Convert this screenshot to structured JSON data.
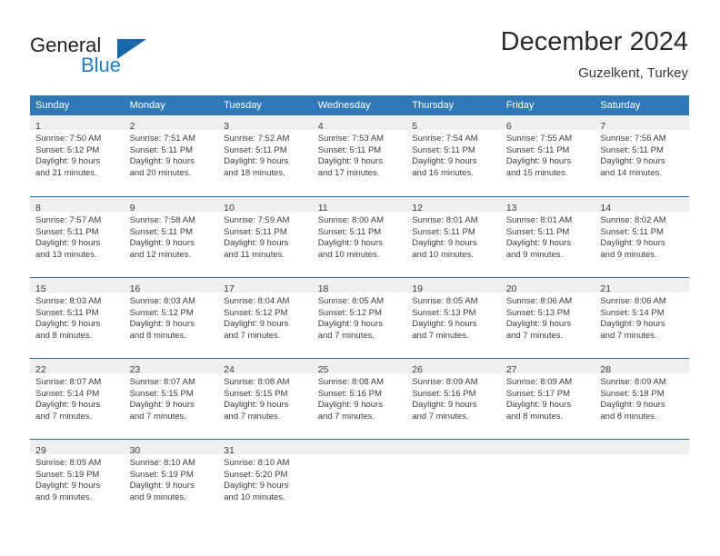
{
  "brand": {
    "name_part1": "General",
    "name_part2": "Blue",
    "triangle_icon": "triangle-logo-icon",
    "blue": "#1f7fc4",
    "dark_blue": "#1767ac"
  },
  "header": {
    "title": "December 2024",
    "subtitle": "Guzelkent, Turkey"
  },
  "theme": {
    "header_blue": "#3079b8",
    "row_divider_blue": "#2e6da4",
    "daynum_band": "#efefef",
    "text": "#3d3d3d"
  },
  "weekday_headers": [
    "Sunday",
    "Monday",
    "Tuesday",
    "Wednesday",
    "Thursday",
    "Friday",
    "Saturday"
  ],
  "weeks": [
    [
      {
        "day": "1",
        "sunrise": "Sunrise: 7:50 AM",
        "sunset": "Sunset: 5:12 PM",
        "daylight1": "Daylight: 9 hours",
        "daylight2": "and 21 minutes."
      },
      {
        "day": "2",
        "sunrise": "Sunrise: 7:51 AM",
        "sunset": "Sunset: 5:11 PM",
        "daylight1": "Daylight: 9 hours",
        "daylight2": "and 20 minutes."
      },
      {
        "day": "3",
        "sunrise": "Sunrise: 7:52 AM",
        "sunset": "Sunset: 5:11 PM",
        "daylight1": "Daylight: 9 hours",
        "daylight2": "and 18 minutes."
      },
      {
        "day": "4",
        "sunrise": "Sunrise: 7:53 AM",
        "sunset": "Sunset: 5:11 PM",
        "daylight1": "Daylight: 9 hours",
        "daylight2": "and 17 minutes."
      },
      {
        "day": "5",
        "sunrise": "Sunrise: 7:54 AM",
        "sunset": "Sunset: 5:11 PM",
        "daylight1": "Daylight: 9 hours",
        "daylight2": "and 16 minutes."
      },
      {
        "day": "6",
        "sunrise": "Sunrise: 7:55 AM",
        "sunset": "Sunset: 5:11 PM",
        "daylight1": "Daylight: 9 hours",
        "daylight2": "and 15 minutes."
      },
      {
        "day": "7",
        "sunrise": "Sunrise: 7:56 AM",
        "sunset": "Sunset: 5:11 PM",
        "daylight1": "Daylight: 9 hours",
        "daylight2": "and 14 minutes."
      }
    ],
    [
      {
        "day": "8",
        "sunrise": "Sunrise: 7:57 AM",
        "sunset": "Sunset: 5:11 PM",
        "daylight1": "Daylight: 9 hours",
        "daylight2": "and 13 minutes."
      },
      {
        "day": "9",
        "sunrise": "Sunrise: 7:58 AM",
        "sunset": "Sunset: 5:11 PM",
        "daylight1": "Daylight: 9 hours",
        "daylight2": "and 12 minutes."
      },
      {
        "day": "10",
        "sunrise": "Sunrise: 7:59 AM",
        "sunset": "Sunset: 5:11 PM",
        "daylight1": "Daylight: 9 hours",
        "daylight2": "and 11 minutes."
      },
      {
        "day": "11",
        "sunrise": "Sunrise: 8:00 AM",
        "sunset": "Sunset: 5:11 PM",
        "daylight1": "Daylight: 9 hours",
        "daylight2": "and 10 minutes."
      },
      {
        "day": "12",
        "sunrise": "Sunrise: 8:01 AM",
        "sunset": "Sunset: 5:11 PM",
        "daylight1": "Daylight: 9 hours",
        "daylight2": "and 10 minutes."
      },
      {
        "day": "13",
        "sunrise": "Sunrise: 8:01 AM",
        "sunset": "Sunset: 5:11 PM",
        "daylight1": "Daylight: 9 hours",
        "daylight2": "and 9 minutes."
      },
      {
        "day": "14",
        "sunrise": "Sunrise: 8:02 AM",
        "sunset": "Sunset: 5:11 PM",
        "daylight1": "Daylight: 9 hours",
        "daylight2": "and 9 minutes."
      }
    ],
    [
      {
        "day": "15",
        "sunrise": "Sunrise: 8:03 AM",
        "sunset": "Sunset: 5:11 PM",
        "daylight1": "Daylight: 9 hours",
        "daylight2": "and 8 minutes."
      },
      {
        "day": "16",
        "sunrise": "Sunrise: 8:03 AM",
        "sunset": "Sunset: 5:12 PM",
        "daylight1": "Daylight: 9 hours",
        "daylight2": "and 8 minutes."
      },
      {
        "day": "17",
        "sunrise": "Sunrise: 8:04 AM",
        "sunset": "Sunset: 5:12 PM",
        "daylight1": "Daylight: 9 hours",
        "daylight2": "and 7 minutes."
      },
      {
        "day": "18",
        "sunrise": "Sunrise: 8:05 AM",
        "sunset": "Sunset: 5:12 PM",
        "daylight1": "Daylight: 9 hours",
        "daylight2": "and 7 minutes."
      },
      {
        "day": "19",
        "sunrise": "Sunrise: 8:05 AM",
        "sunset": "Sunset: 5:13 PM",
        "daylight1": "Daylight: 9 hours",
        "daylight2": "and 7 minutes."
      },
      {
        "day": "20",
        "sunrise": "Sunrise: 8:06 AM",
        "sunset": "Sunset: 5:13 PM",
        "daylight1": "Daylight: 9 hours",
        "daylight2": "and 7 minutes."
      },
      {
        "day": "21",
        "sunrise": "Sunrise: 8:06 AM",
        "sunset": "Sunset: 5:14 PM",
        "daylight1": "Daylight: 9 hours",
        "daylight2": "and 7 minutes."
      }
    ],
    [
      {
        "day": "22",
        "sunrise": "Sunrise: 8:07 AM",
        "sunset": "Sunset: 5:14 PM",
        "daylight1": "Daylight: 9 hours",
        "daylight2": "and 7 minutes."
      },
      {
        "day": "23",
        "sunrise": "Sunrise: 8:07 AM",
        "sunset": "Sunset: 5:15 PM",
        "daylight1": "Daylight: 9 hours",
        "daylight2": "and 7 minutes."
      },
      {
        "day": "24",
        "sunrise": "Sunrise: 8:08 AM",
        "sunset": "Sunset: 5:15 PM",
        "daylight1": "Daylight: 9 hours",
        "daylight2": "and 7 minutes."
      },
      {
        "day": "25",
        "sunrise": "Sunrise: 8:08 AM",
        "sunset": "Sunset: 5:16 PM",
        "daylight1": "Daylight: 9 hours",
        "daylight2": "and 7 minutes."
      },
      {
        "day": "26",
        "sunrise": "Sunrise: 8:09 AM",
        "sunset": "Sunset: 5:16 PM",
        "daylight1": "Daylight: 9 hours",
        "daylight2": "and 7 minutes."
      },
      {
        "day": "27",
        "sunrise": "Sunrise: 8:09 AM",
        "sunset": "Sunset: 5:17 PM",
        "daylight1": "Daylight: 9 hours",
        "daylight2": "and 8 minutes."
      },
      {
        "day": "28",
        "sunrise": "Sunrise: 8:09 AM",
        "sunset": "Sunset: 5:18 PM",
        "daylight1": "Daylight: 9 hours",
        "daylight2": "and 8 minutes."
      }
    ],
    [
      {
        "day": "29",
        "sunrise": "Sunrise: 8:09 AM",
        "sunset": "Sunset: 5:19 PM",
        "daylight1": "Daylight: 9 hours",
        "daylight2": "and 9 minutes."
      },
      {
        "day": "30",
        "sunrise": "Sunrise: 8:10 AM",
        "sunset": "Sunset: 5:19 PM",
        "daylight1": "Daylight: 9 hours",
        "daylight2": "and 9 minutes."
      },
      {
        "day": "31",
        "sunrise": "Sunrise: 8:10 AM",
        "sunset": "Sunset: 5:20 PM",
        "daylight1": "Daylight: 9 hours",
        "daylight2": "and 10 minutes."
      },
      {
        "day": "",
        "sunrise": "",
        "sunset": "",
        "daylight1": "",
        "daylight2": ""
      },
      {
        "day": "",
        "sunrise": "",
        "sunset": "",
        "daylight1": "",
        "daylight2": ""
      },
      {
        "day": "",
        "sunrise": "",
        "sunset": "",
        "daylight1": "",
        "daylight2": ""
      },
      {
        "day": "",
        "sunrise": "",
        "sunset": "",
        "daylight1": "",
        "daylight2": ""
      }
    ]
  ]
}
